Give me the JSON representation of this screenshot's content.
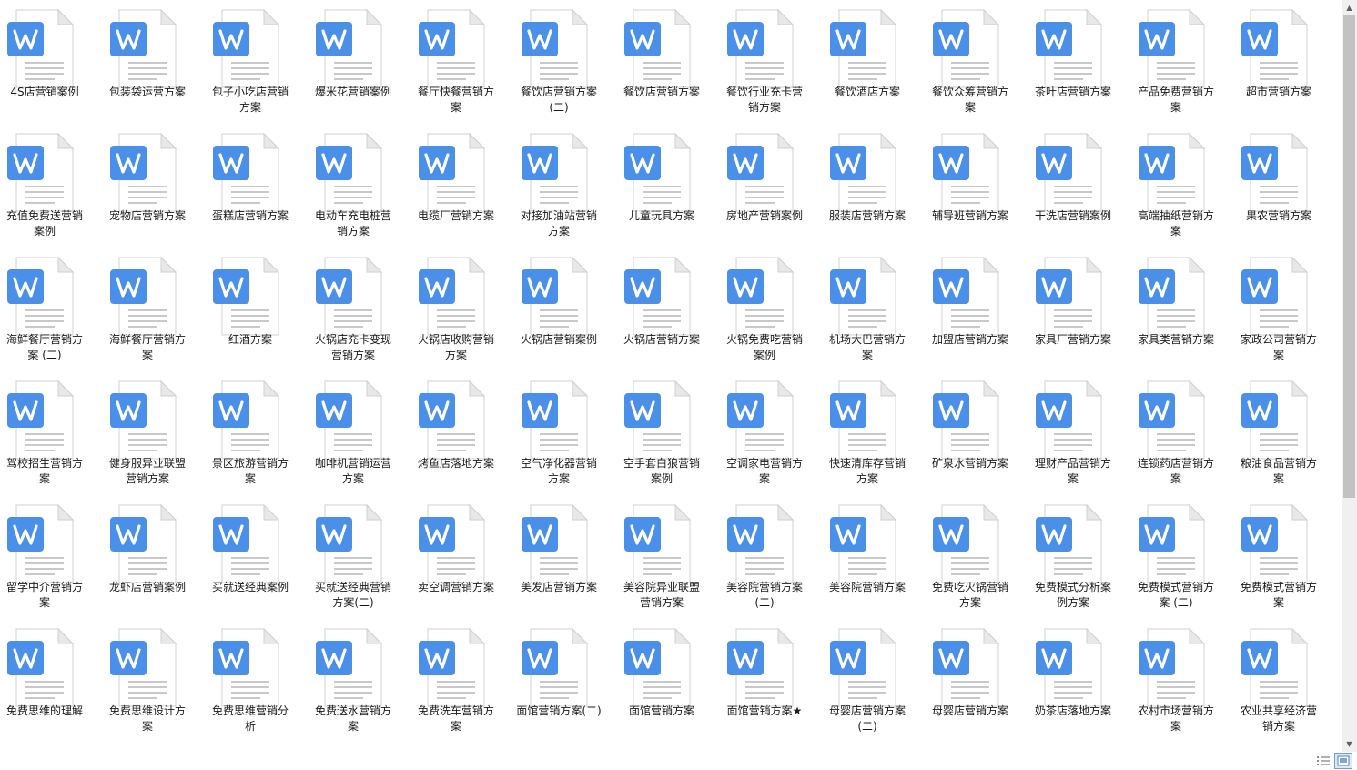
{
  "files": [
    "4S店营销案例",
    "包装袋运营方案",
    "包子小吃店营销方案",
    "爆米花营销案例",
    "餐厅快餐营销方案",
    "餐饮店营销方案(二)",
    "餐饮店营销方案",
    "餐饮行业充卡营销方案",
    "餐饮酒店方案",
    "餐饮众筹营销方案",
    "茶叶店营销方案",
    "产品免费营销方案",
    "超市营销方案",
    "充值免费送营销案例",
    "宠物店营销方案",
    "蛋糕店营销方案",
    "电动车充电桩营销方案",
    "电缆厂营销方案",
    "对接加油站营销方案",
    "儿童玩具方案",
    "房地产营销案例",
    "服装店营销方案",
    "辅导班营销方案",
    "干洗店营销案例",
    "高端抽纸营销方案",
    "果农营销方案",
    "海鲜餐厅营销方案 (二)",
    "海鲜餐厅营销方案",
    "红酒方案",
    "火锅店充卡变现营销方案",
    "火锅店收购营销方案",
    "火锅店营销案例",
    "火锅店营销方案",
    "火锅免费吃营销案例",
    "机场大巴营销方案",
    "加盟店营销方案",
    "家具厂营销方案",
    "家具类营销方案",
    "家政公司营销方案",
    "驾校招生营销方案",
    "健身服异业联盟营销方案",
    "景区旅游营销方案",
    "咖啡机营销运营方案",
    "烤鱼店落地方案",
    "空气净化器营销方案",
    "空手套白狼营销案例",
    "空调家电营销方案",
    "快速清库存营销方案",
    "矿泉水营销方案",
    "理财产品营销方案",
    "连锁药店营销方案",
    "粮油食品营销方案",
    "留学中介营销方案",
    "龙虾店营销案例",
    "买就送经典案例",
    "买就送经典营销方案(二)",
    "卖空调营销方案",
    "美发店营销方案",
    "美容院异业联盟营销方案",
    "美容院营销方案(二)",
    "美容院营销方案",
    "免费吃火锅营销方案",
    "免费模式分析案例方案",
    "免费模式营销方案 (二)",
    "免费模式营销方案",
    "免费思维的理解",
    "免费思维设计方案",
    "免费思维营销分析",
    "免费送水营销方案",
    "免费洗车营销方案",
    "面馆营销方案(二)",
    "面馆营销方案",
    "面馆营销方案★",
    "母婴店营销方案 (二)",
    "母婴店营销方案",
    "奶茶店落地方案",
    "农村市场营销方案",
    "农业共享经济营销方案"
  ],
  "icon": "wps-writer-document-icon",
  "colors": {
    "accent": "#4a8fe8",
    "page": "#ffffff",
    "fold": "#e8e8e8",
    "lines": "#c9c9c9"
  },
  "scrollbar": {
    "position_fraction": 0.0,
    "visible_fraction": 0.65
  },
  "view_modes": [
    "details-view-icon",
    "large-icons-view-icon"
  ]
}
